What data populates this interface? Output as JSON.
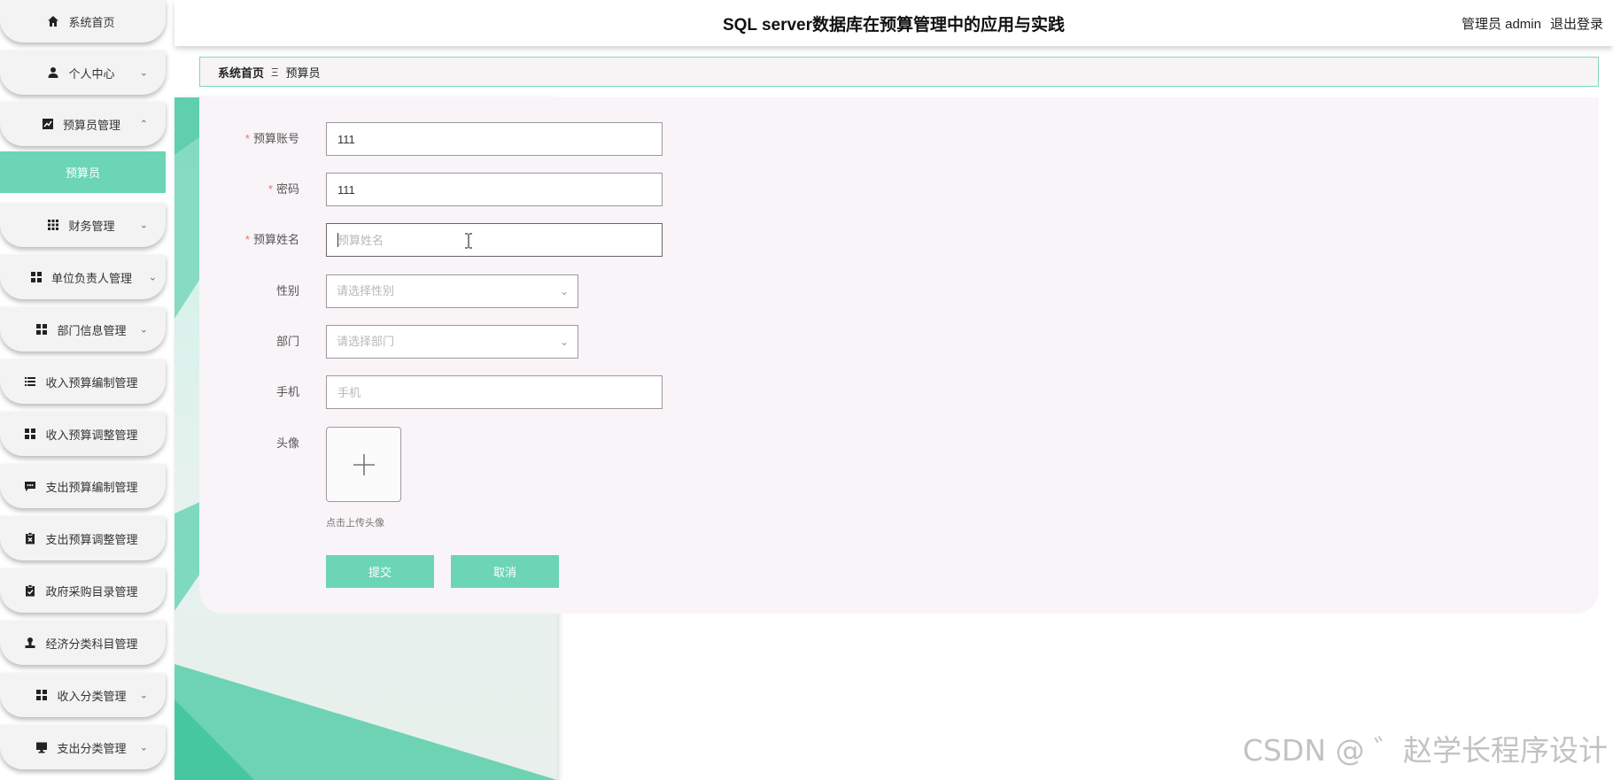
{
  "header": {
    "title": "SQL server数据库在预算管理中的应用与实践",
    "role": "管理员 admin",
    "logout": "退出登录"
  },
  "sidebar": {
    "items": [
      {
        "label": "系统首页",
        "icon": "home-icon"
      },
      {
        "label": "个人中心",
        "icon": "person-icon"
      },
      {
        "label": "预算员管理",
        "icon": "chart-icon"
      },
      {
        "label": "财务管理",
        "icon": "grid-icon"
      },
      {
        "label": "单位负责人管理",
        "icon": "apps-icon"
      },
      {
        "label": "部门信息管理",
        "icon": "apps-icon"
      },
      {
        "label": "收入预算编制管理",
        "icon": "list-icon"
      },
      {
        "label": "收入预算调整管理",
        "icon": "apps-icon"
      },
      {
        "label": "支出预算编制管理",
        "icon": "chat-icon"
      },
      {
        "label": "支出预算调整管理",
        "icon": "clipboard-x-icon"
      },
      {
        "label": "政府采购目录管理",
        "icon": "clipboard-check-icon"
      },
      {
        "label": "经济分类科目管理",
        "icon": "stamp-icon"
      },
      {
        "label": "收入分类管理",
        "icon": "apps-icon"
      },
      {
        "label": "支出分类管理",
        "icon": "monitor-icon"
      }
    ],
    "active_sub": "预算员"
  },
  "breadcrumb": {
    "home": "系统首页",
    "separator": "Ξ",
    "current": "预算员"
  },
  "form": {
    "account_label": "预算账号",
    "account_value": "111",
    "password_label": "密码",
    "password_value": "111",
    "name_label": "预算姓名",
    "name_placeholder": "预算姓名",
    "gender_label": "性别",
    "gender_placeholder": "请选择性别",
    "dept_label": "部门",
    "dept_placeholder": "请选择部门",
    "phone_label": "手机",
    "phone_placeholder": "手机",
    "avatar_label": "头像",
    "avatar_tip": "点击上传头像",
    "submit": "提交",
    "cancel": "取消",
    "required_mark": "*"
  },
  "watermark": "CSDN @ ゛赵学长程序设计",
  "colors": {
    "accent": "#6bd5b6",
    "required": "#f56c6c"
  }
}
